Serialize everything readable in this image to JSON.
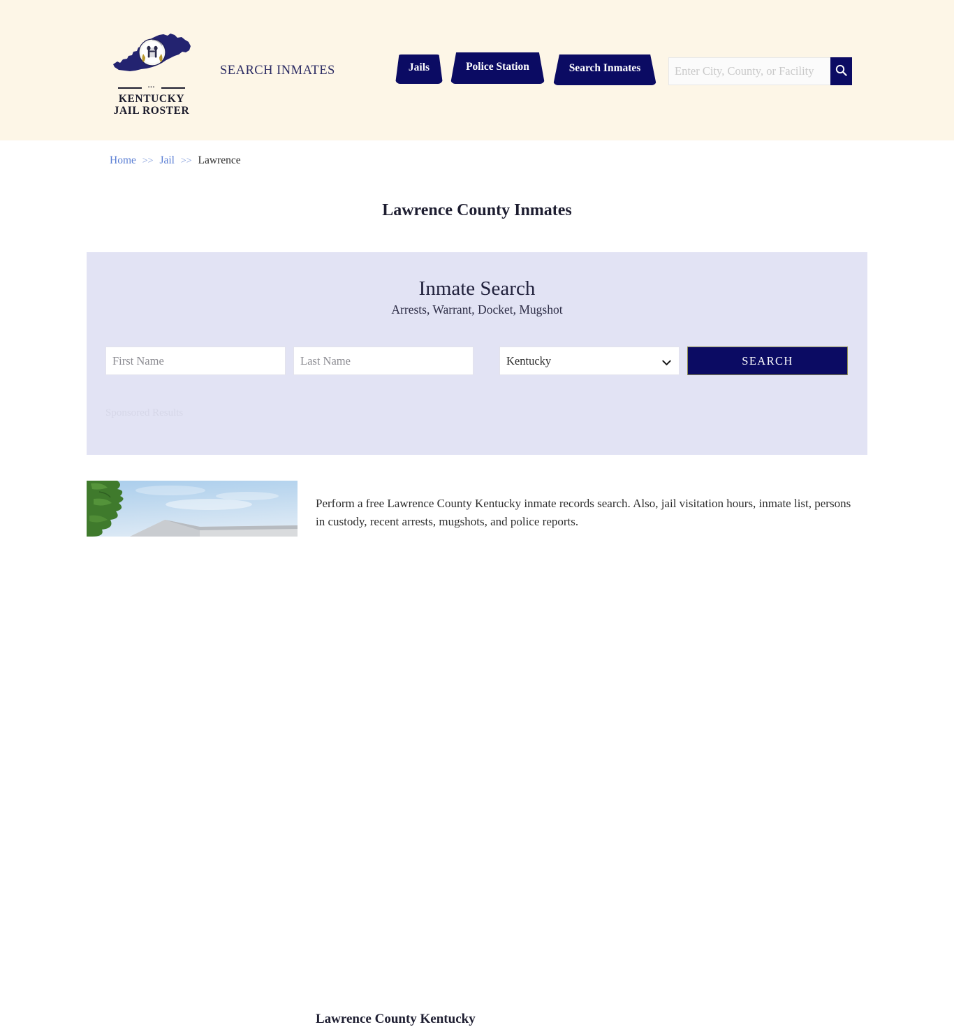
{
  "header": {
    "logo": {
      "icon": "kentucky-state-map-with-seal",
      "line1": "KENTUCKY",
      "line2": "JAIL ROSTER",
      "divider_dots": "•••"
    },
    "tagline": "SEARCH INMATES",
    "nav": [
      {
        "label": "Jails"
      },
      {
        "label": "Police Station"
      },
      {
        "label": "Search Inmates"
      }
    ],
    "search": {
      "value": "",
      "placeholder": "Enter City, County, or Facility",
      "button_icon": "search-icon"
    },
    "background_color": "#FDF6E7",
    "accent_color": "#0B0B63"
  },
  "breadcrumb": {
    "items": [
      {
        "label": "Home",
        "link": true
      },
      {
        "label": "Jail",
        "link": true
      },
      {
        "label": "Lawrence",
        "link": false
      }
    ],
    "separator": ">>"
  },
  "page_title": "Lawrence County Inmates",
  "panel": {
    "title": "Inmate Search",
    "subtitle": "Arrests, Warrant, Docket, Mugshot",
    "background_color": "#E2E3F4",
    "form": {
      "first_name": {
        "value": "",
        "placeholder": "First Name"
      },
      "last_name": {
        "value": "",
        "placeholder": "Last Name"
      },
      "state": {
        "selected": "Kentucky",
        "options": [
          "Kentucky"
        ]
      },
      "submit_label": "SEARCH"
    },
    "sponsored_label": "Sponsored Results"
  },
  "content": {
    "thumbnail_alt": "lawrence-county-jail-building-photo",
    "paragraph": "Perform a free Lawrence County Kentucky inmate records search. Also, jail visitation hours, inmate list, persons in custody, recent arrests, mugshots, and police reports.",
    "subheading": "Lawrence County Kentucky"
  }
}
